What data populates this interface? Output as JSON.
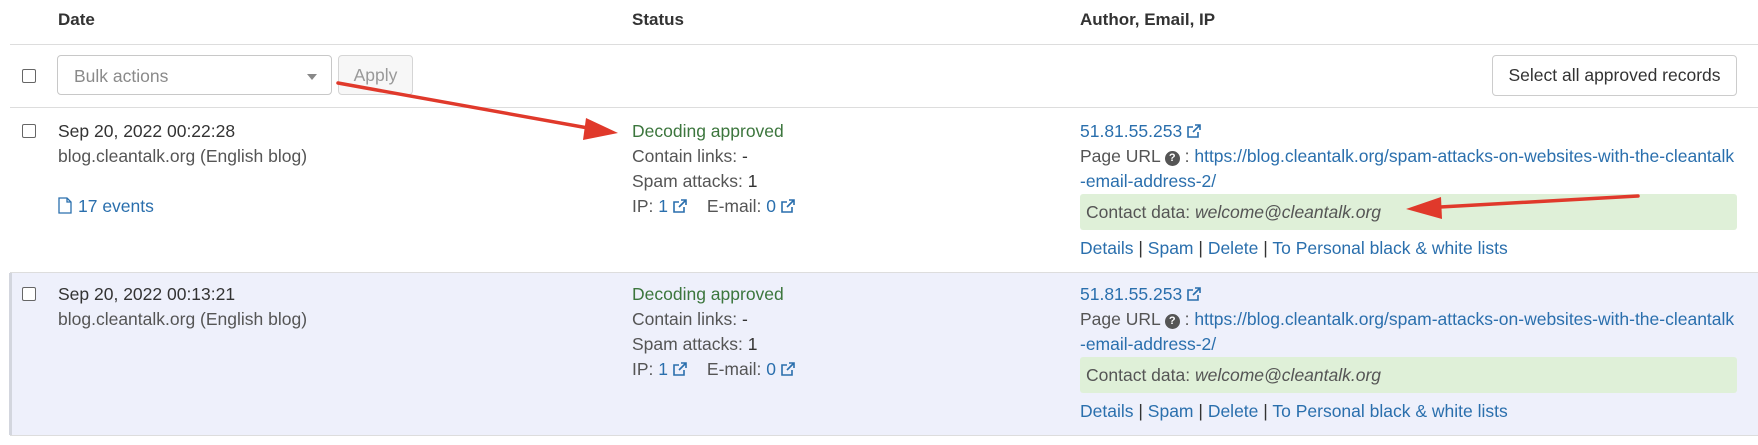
{
  "header": {
    "date": "Date",
    "status": "Status",
    "author": "Author, Email, IP"
  },
  "toolbar": {
    "bulk_placeholder": "Bulk actions",
    "apply_label": "Apply",
    "select_all_label": "Select all approved records"
  },
  "rows": [
    {
      "date": "Sep 20, 2022 00:22:28",
      "site": "blog.cleantalk.org (English blog)",
      "events": "17 events",
      "status": "Decoding approved",
      "contain_links_label": "Contain links:",
      "contain_links_value": "-",
      "spam_attacks_label": "Spam attacks:",
      "spam_attacks_value": "1",
      "ip_label": "IP:",
      "ip_count": "1",
      "email_label": "E-mail:",
      "email_count": "0",
      "ip_address": "51.81.55.253",
      "page_url_label": "Page URL",
      "page_url_line1": "https://blog.cleantalk.org/spam-attacks-on-websites-with-the-cleantalk",
      "page_url_line2": "-email-address-2/",
      "contact_label": "Contact data:",
      "contact_value": "welcome@cleantalk.org",
      "actions": {
        "details": "Details",
        "spam": "Spam",
        "delete": "Delete",
        "lists": "To Personal black & white lists"
      }
    },
    {
      "date": "Sep 20, 2022 00:13:21",
      "site": "blog.cleantalk.org (English blog)",
      "status": "Decoding approved",
      "contain_links_label": "Contain links:",
      "contain_links_value": "-",
      "spam_attacks_label": "Spam attacks:",
      "spam_attacks_value": "1",
      "ip_label": "IP:",
      "ip_count": "1",
      "email_label": "E-mail:",
      "email_count": "0",
      "ip_address": "51.81.55.253",
      "page_url_label": "Page URL",
      "page_url_line1": "https://blog.cleantalk.org/spam-attacks-on-websites-with-the-cleantalk",
      "page_url_line2": "-email-address-2/",
      "contact_label": "Contact data:",
      "contact_value": "welcome@cleantalk.org",
      "actions": {
        "details": "Details",
        "spam": "Spam",
        "delete": "Delete",
        "lists": "To Personal black & white lists"
      }
    }
  ],
  "colors": {
    "link": "#2a6fad",
    "approved": "#3c763d",
    "contact_bg": "#dff0d8",
    "arrow": "#e0392b",
    "selected_row_bg": "#eef0fb"
  },
  "icons": [
    "external-link-icon",
    "question-circle-icon",
    "document-icon",
    "caret-down-icon",
    "red-arrow-annotation"
  ]
}
